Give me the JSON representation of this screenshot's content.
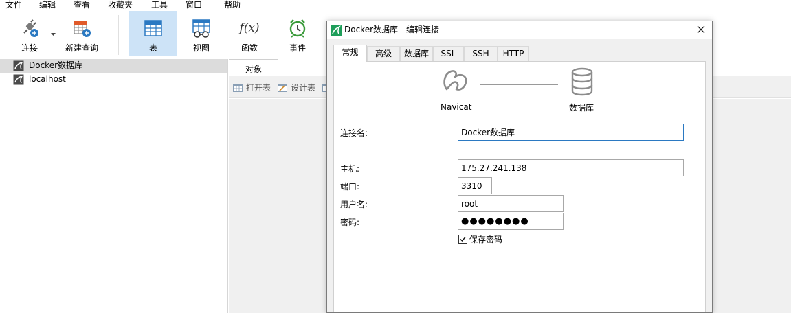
{
  "menu": [
    "文件",
    "编辑",
    "查看",
    "收藏夹",
    "工具",
    "窗口",
    "帮助"
  ],
  "toolbar": {
    "connect": "连接",
    "new_query": "新建查询",
    "table": "表",
    "view": "视图",
    "function": "函数",
    "event": "事件",
    "function_glyph": "f(x)"
  },
  "tree": [
    "Docker数据库",
    "localhost"
  ],
  "objects": {
    "tab": "对象",
    "open_table": "打开表",
    "design_table": "设计表"
  },
  "dialog": {
    "title": "Docker数据库 - 编辑连接",
    "tabs": [
      "常规",
      "高级",
      "数据库",
      "SSL",
      "SSH",
      "HTTP"
    ],
    "active_tab": "常规",
    "flow": {
      "left": "Navicat",
      "right": "数据库"
    },
    "fields": {
      "conn_name_label": "连接名:",
      "conn_name": "Docker数据库",
      "host_label": "主机:",
      "host": "175.27.241.138",
      "port_label": "端口:",
      "port": "3310",
      "user_label": "用户名:",
      "user": "root",
      "pwd_label": "密码:",
      "pwd": "●●●●●●●●"
    },
    "save_password": "保存密码",
    "save_password_checked": true
  },
  "colors": {
    "accent": "#2b79c2",
    "active_toolbar": "#cde3f7",
    "navicat_green": "#1e9e5a"
  }
}
